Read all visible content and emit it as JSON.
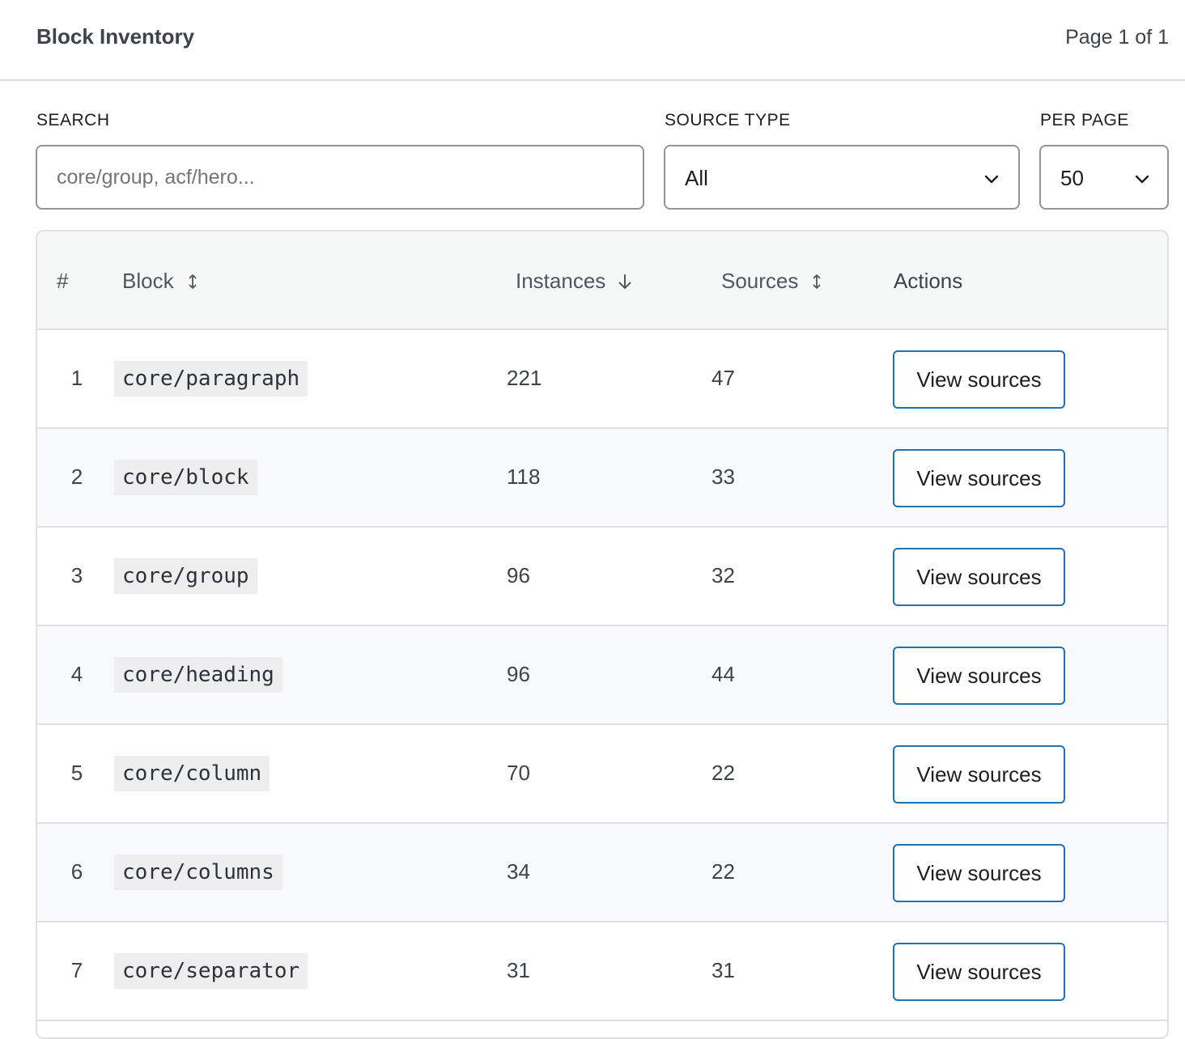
{
  "header": {
    "title": "Block Inventory",
    "page_indicator": "Page 1 of 1"
  },
  "filters": {
    "search_label": "SEARCH",
    "search_placeholder": "core/group, acf/hero...",
    "source_type_label": "SOURCE TYPE",
    "source_type_value": "All",
    "per_page_label": "PER PAGE",
    "per_page_value": "50"
  },
  "table": {
    "columns": {
      "index": "#",
      "block": "Block",
      "instances": "Instances",
      "sources": "Sources",
      "actions": "Actions"
    },
    "sort": {
      "column": "instances",
      "direction": "descending"
    },
    "rows": [
      {
        "index": "1",
        "block": "core/paragraph",
        "instances": "221",
        "sources": "47",
        "action": "View sources"
      },
      {
        "index": "2",
        "block": "core/block",
        "instances": "118",
        "sources": "33",
        "action": "View sources"
      },
      {
        "index": "3",
        "block": "core/group",
        "instances": "96",
        "sources": "32",
        "action": "View sources"
      },
      {
        "index": "4",
        "block": "core/heading",
        "instances": "96",
        "sources": "44",
        "action": "View sources"
      },
      {
        "index": "5",
        "block": "core/column",
        "instances": "70",
        "sources": "22",
        "action": "View sources"
      },
      {
        "index": "6",
        "block": "core/columns",
        "instances": "34",
        "sources": "22",
        "action": "View sources"
      },
      {
        "index": "7",
        "block": "core/separator",
        "instances": "31",
        "sources": "31",
        "action": "View sources"
      }
    ]
  },
  "colors": {
    "accent": "#2271b1",
    "border": "#949494",
    "row_alt": "#f8f9fb",
    "header_bg": "#f6f7f7",
    "code_bg": "#eeeeee"
  },
  "icons": {
    "sortable": "sort-updown-icon",
    "sorted_desc": "arrow-down-icon",
    "select": "chevron-down-icon"
  }
}
